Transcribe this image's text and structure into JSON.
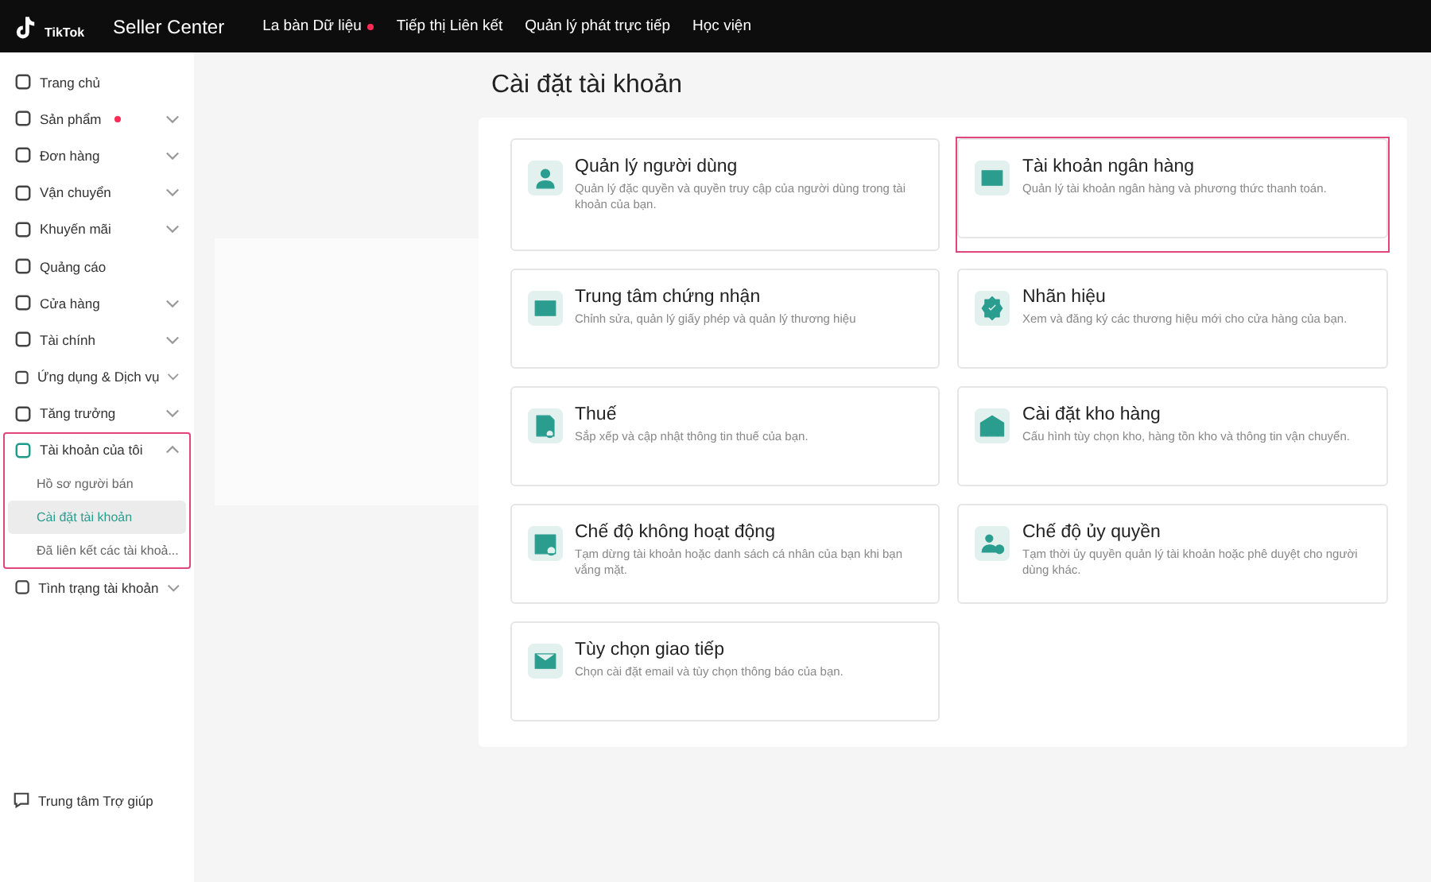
{
  "topbar": {
    "brand_small": "TikTok",
    "brand": "Seller Center",
    "nav": [
      {
        "label": "La bàn Dữ liệu",
        "dot": true
      },
      {
        "label": "Tiếp thị Liên kết",
        "dot": false
      },
      {
        "label": "Quản lý phát trực tiếp",
        "dot": false
      },
      {
        "label": "Học viện",
        "dot": false
      }
    ]
  },
  "sidebar": {
    "items": [
      {
        "label": "Trang chủ",
        "dot": false,
        "has_children": false,
        "expanded": false,
        "highlighted": false
      },
      {
        "label": "Sản phẩm",
        "dot": true,
        "has_children": true,
        "expanded": false,
        "highlighted": false
      },
      {
        "label": "Đơn hàng",
        "dot": false,
        "has_children": true,
        "expanded": false,
        "highlighted": false
      },
      {
        "label": "Vận chuyển",
        "dot": false,
        "has_children": true,
        "expanded": false,
        "highlighted": false
      },
      {
        "label": "Khuyến mãi",
        "dot": false,
        "has_children": true,
        "expanded": false,
        "highlighted": false
      },
      {
        "label": "Quảng cáo",
        "dot": false,
        "has_children": false,
        "expanded": false,
        "highlighted": false
      },
      {
        "label": "Cửa hàng",
        "dot": false,
        "has_children": true,
        "expanded": false,
        "highlighted": false
      },
      {
        "label": "Tài chính",
        "dot": false,
        "has_children": true,
        "expanded": false,
        "highlighted": false
      },
      {
        "label": "Ứng dụng & Dịch vụ",
        "dot": false,
        "has_children": true,
        "expanded": false,
        "highlighted": false
      },
      {
        "label": "Tăng trưởng",
        "dot": false,
        "has_children": true,
        "expanded": false,
        "highlighted": false
      },
      {
        "label": "Tài khoản của tôi",
        "dot": false,
        "has_children": true,
        "expanded": true,
        "highlighted": true,
        "children": [
          {
            "label": "Hồ sơ người bán",
            "selected": false
          },
          {
            "label": "Cài đặt tài khoản",
            "selected": true
          },
          {
            "label": "Đã liên kết các tài khoả...",
            "selected": false
          }
        ]
      },
      {
        "label": "Tình trạng tài khoản",
        "dot": false,
        "has_children": true,
        "expanded": false,
        "highlighted": false
      }
    ],
    "help": "Trung tâm Trợ giúp"
  },
  "page": {
    "title": "Cài đặt tài khoản",
    "cards": [
      {
        "title": "Quản lý người dùng",
        "description": "Quản lý đặc quyền và quyền truy cập của người dùng trong tài khoản của bạn.",
        "highlighted": false
      },
      {
        "title": "Tài khoản ngân hàng",
        "description": "Quản lý tài khoản ngân hàng và phương thức thanh toán.",
        "highlighted": true
      },
      {
        "title": "Trung tâm chứng nhận",
        "description": "Chỉnh sửa, quản lý giấy phép và quản lý thương hiệu",
        "highlighted": false
      },
      {
        "title": "Nhãn hiệu",
        "description": "Xem và đăng ký các thương hiệu mới cho cửa hàng của bạn.",
        "highlighted": false
      },
      {
        "title": "Thuế",
        "description": "Sắp xếp và cập nhật thông tin thuế của bạn.",
        "highlighted": false
      },
      {
        "title": "Cài đặt kho hàng",
        "description": "Cấu hình tùy chọn kho, hàng tồn kho và thông tin vận chuyển.",
        "highlighted": false
      },
      {
        "title": "Chế độ không hoạt động",
        "description": "Tạm dừng tài khoản hoặc danh sách cá nhân của bạn khi bạn vắng mặt.",
        "highlighted": false
      },
      {
        "title": "Chế độ ủy quyền",
        "description": "Tạm thời ủy quyền quản lý tài khoản hoặc phê duyệt cho người dùng khác.",
        "highlighted": false
      },
      {
        "title": "Tùy chọn giao tiếp",
        "description": "Chọn cài đặt email và tùy chọn thông báo của bạn.",
        "highlighted": false
      }
    ]
  }
}
